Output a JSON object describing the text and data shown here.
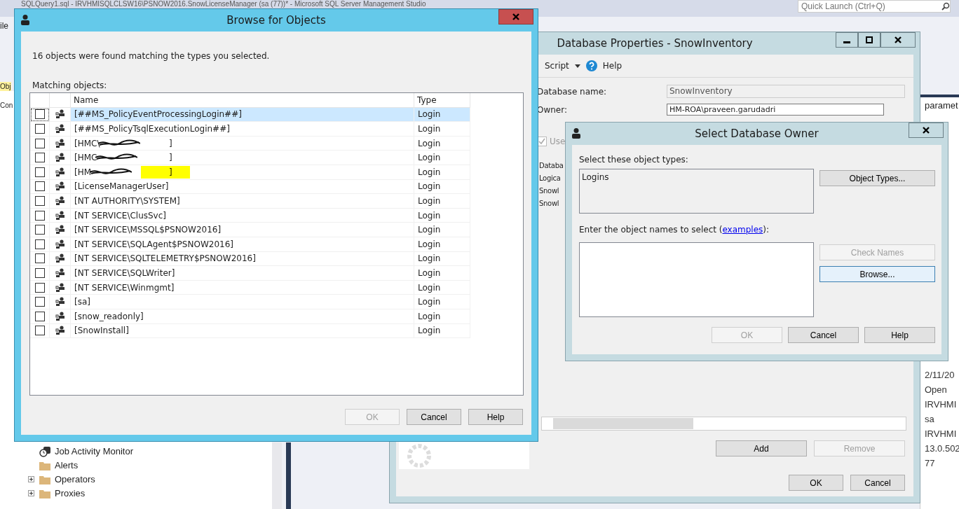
{
  "app": {
    "title": "SQLQuery1.sql - IRVHMISQLCLSW16\\PSNOW2016.SnowLicenseManager (sa (77))* - Microsoft SQL Server Management Studio",
    "quick_launch": {
      "placeholder": "Quick Launch (Ctrl+Q)"
    },
    "menu_fragment": "ile",
    "explorer_tab": "Obj",
    "connect_fragment": "Con",
    "tree": [
      {
        "label": "Job Activity Monitor",
        "kind": "monitor",
        "expandable": false
      },
      {
        "label": "Alerts",
        "kind": "folder",
        "expandable": false
      },
      {
        "label": "Operators",
        "kind": "folder",
        "expandable": true
      },
      {
        "label": "Proxies",
        "kind": "folder",
        "expandable": true
      }
    ],
    "right_panel": {
      "header": "paramet",
      "values": [
        "2/11/20",
        "Open",
        "IRVHMI",
        "sa",
        "IRVHMI",
        "13.0.502",
        "77"
      ]
    }
  },
  "database_properties": {
    "title": "Database Properties - SnowInventory",
    "toolbar": [
      "Script",
      "Help"
    ],
    "name_label": "Database name:",
    "name_value": "SnowInventory",
    "owner_label": "Owner:",
    "owner_value": "HM-ROA\\praveen.garudadri",
    "use_label": "Use",
    "use_checked": true,
    "grid_fragments": [
      "Databa",
      "Logica",
      "Snowl",
      "Snowl"
    ],
    "buttons": [
      {
        "label": "Add",
        "disabled": false
      },
      {
        "label": "Remove",
        "disabled": true
      }
    ],
    "footer": [
      {
        "label": "OK",
        "disabled": false
      },
      {
        "label": "Cancel",
        "disabled": false
      }
    ]
  },
  "browse_dialog": {
    "title": "Browse for Objects",
    "message": "16 objects were found matching the types you selected.",
    "list_label": "Matching objects:",
    "columns": [
      "Name",
      "Type"
    ],
    "rows": [
      {
        "name": "[##MS_PolicyEventProcessingLogin##]",
        "type": "Login",
        "checked": false,
        "selected": true
      },
      {
        "name": "[##MS_PolicyTsqlExecutionLogin##]",
        "type": "Login",
        "checked": false,
        "selected": false
      },
      {
        "name": "[HMC\\",
        "name_end": "]",
        "redacted": true,
        "type": "Login",
        "checked": false,
        "selected": false
      },
      {
        "name": "[HMC",
        "name_end": "]",
        "redacted": true,
        "type": "Login",
        "checked": false,
        "selected": false
      },
      {
        "name": "[HM",
        "name_end": "]",
        "redacted": true,
        "highlight": true,
        "type": "Login",
        "checked": false,
        "selected": false
      },
      {
        "name": "[LicenseManagerUser]",
        "type": "Login",
        "checked": false,
        "selected": false
      },
      {
        "name": "[NT AUTHORITY\\SYSTEM]",
        "type": "Login",
        "checked": false,
        "selected": false
      },
      {
        "name": "[NT SERVICE\\ClusSvc]",
        "type": "Login",
        "checked": false,
        "selected": false
      },
      {
        "name": "[NT SERVICE\\MSSQL$PSNOW2016]",
        "type": "Login",
        "checked": false,
        "selected": false
      },
      {
        "name": "[NT SERVICE\\SQLAgent$PSNOW2016]",
        "type": "Login",
        "checked": false,
        "selected": false
      },
      {
        "name": "[NT SERVICE\\SQLTELEMETRY$PSNOW2016]",
        "type": "Login",
        "checked": false,
        "selected": false
      },
      {
        "name": "[NT SERVICE\\SQLWriter]",
        "type": "Login",
        "checked": false,
        "selected": false
      },
      {
        "name": "[NT SERVICE\\Winmgmt]",
        "type": "Login",
        "checked": false,
        "selected": false
      },
      {
        "name": "[sa]",
        "type": "Login",
        "checked": false,
        "selected": false
      },
      {
        "name": "[snow_readonly]",
        "type": "Login",
        "checked": false,
        "selected": false
      },
      {
        "name": "[SnowInstall]",
        "type": "Login",
        "checked": false,
        "selected": false
      }
    ],
    "buttons": [
      {
        "label": "OK",
        "disabled": true
      },
      {
        "label": "Cancel",
        "disabled": false
      },
      {
        "label": "Help",
        "disabled": false
      }
    ]
  },
  "owner_dialog": {
    "title": "Select Database Owner",
    "types_label": "Select these object types:",
    "types_value": "Logins",
    "types_button": "Object Types...",
    "names_label": "Enter the object names to select (",
    "names_link": "examples",
    "names_label_end": "):",
    "side_buttons": [
      {
        "label": "Check Names",
        "disabled": true,
        "focused": false
      },
      {
        "label": "Browse...",
        "disabled": false,
        "focused": true
      }
    ],
    "buttons": [
      {
        "label": "OK",
        "disabled": true
      },
      {
        "label": "Cancel",
        "disabled": false
      },
      {
        "label": "Help",
        "disabled": false
      }
    ]
  }
}
